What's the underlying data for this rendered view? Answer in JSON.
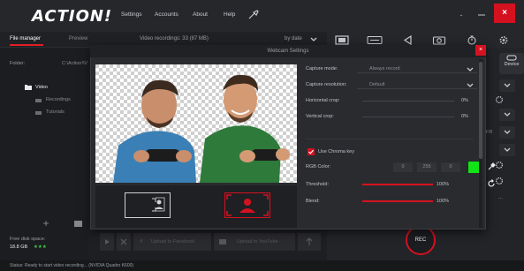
{
  "app": {
    "logo": "ACTION!",
    "menu": [
      "Settings",
      "Accounts",
      "About",
      "Help"
    ],
    "window_min": "-",
    "window_close": "×"
  },
  "tabs": {
    "file_manager": "File manager",
    "preview": "Preview"
  },
  "recordings_count": "Video recordings: 33 (87 MB)",
  "sort_by": "by date",
  "sidebar": {
    "folder_label": "Folder:",
    "folder_path": "C:\\Action!\\V",
    "tree": [
      {
        "label": "Video"
      },
      {
        "label": "Recordings"
      },
      {
        "label": "Tutorials"
      }
    ],
    "add_button": "+",
    "disk_label": "Free disk space:",
    "disk_value": "18.8 GB",
    "disk_stars": "★★★"
  },
  "right_panel": {
    "device_label": "Device",
    "partial_text": "FR",
    "dots": "...",
    "rec_label": "REC"
  },
  "upload": {
    "facebook": "Upload to Facebook",
    "youtube": "Upload to YouTube"
  },
  "status": {
    "text": "Status:  Ready to start video recording...  (NVIDIA Quadro K600)"
  },
  "dialog": {
    "title": "Webcam Settings",
    "close": "×",
    "capture_mode_label": "Capture mode:",
    "capture_mode_value": "Always record",
    "capture_resolution_label": "Capture resolution:",
    "capture_resolution_value": "Default",
    "horizontal_crop_label": "Horizontal crop:",
    "horizontal_crop_value": "0%",
    "vertical_crop_label": "Vertical crop:",
    "vertical_crop_value": "0%",
    "chroma_key_label": "Use Chroma key",
    "rgb_label": "RGB Color:",
    "rgb": [
      "0",
      "255",
      "0"
    ],
    "threshold_label": "Threshold:",
    "threshold_value": "100%",
    "blend_label": "Blend:",
    "blend_value": "100%",
    "threshold_level": 1.0,
    "blend_level": 1.0
  },
  "colors": {
    "accent": "#d51120",
    "chroma": "#12e316"
  }
}
